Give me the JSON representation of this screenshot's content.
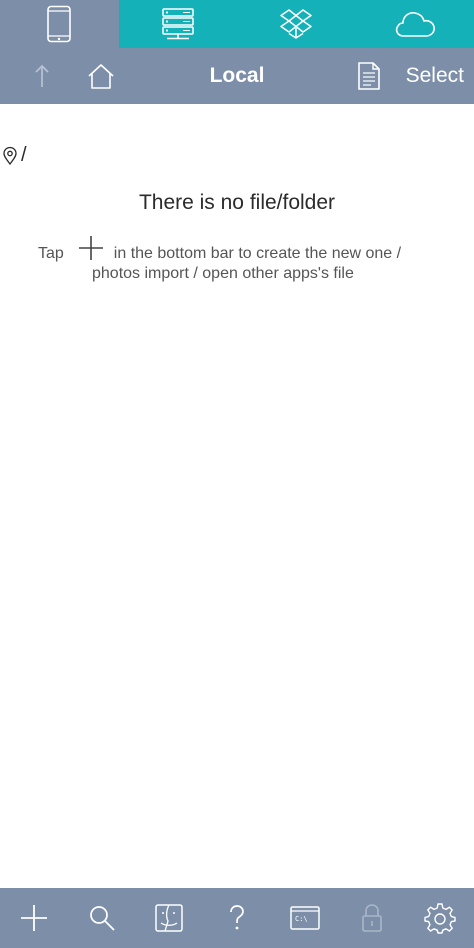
{
  "tabs": [
    {
      "name": "local-device"
    },
    {
      "name": "network-server"
    },
    {
      "name": "dropbox"
    },
    {
      "name": "icloud"
    }
  ],
  "navbar": {
    "title": "Local",
    "select_label": "Select"
  },
  "path": {
    "current": "/"
  },
  "empty_state": {
    "title": "There is no file/folder",
    "hint_prefix": "Tap",
    "hint_line1": "in the bottom bar to create the new one /",
    "hint_line2": "photos import / open other apps's file"
  },
  "toolbar": {
    "items": [
      "add",
      "search",
      "finder",
      "help",
      "terminal",
      "lock",
      "settings"
    ]
  },
  "colors": {
    "bar": "#7d8fa8",
    "accent_tab": "#15b1b8",
    "background": "#ffffff"
  }
}
